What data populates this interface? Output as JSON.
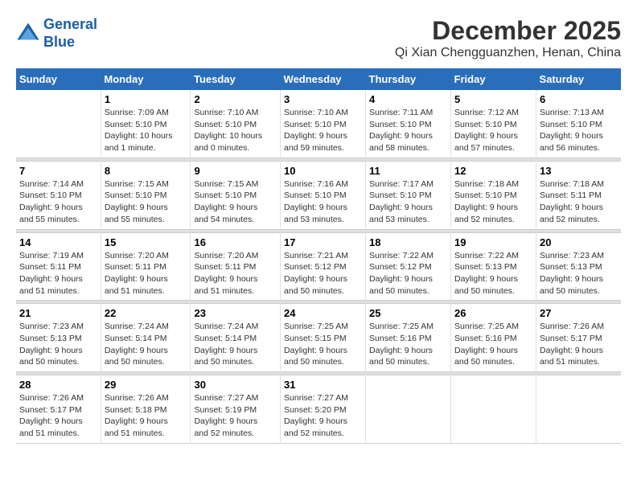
{
  "logo": {
    "line1": "General",
    "line2": "Blue"
  },
  "title": "December 2025",
  "location": "Qi Xian Chengguanzhen, Henan, China",
  "weekdays": [
    "Sunday",
    "Monday",
    "Tuesday",
    "Wednesday",
    "Thursday",
    "Friday",
    "Saturday"
  ],
  "weeks": [
    [
      {
        "day": "",
        "info": ""
      },
      {
        "day": "1",
        "info": "Sunrise: 7:09 AM\nSunset: 5:10 PM\nDaylight: 10 hours\nand 1 minute."
      },
      {
        "day": "2",
        "info": "Sunrise: 7:10 AM\nSunset: 5:10 PM\nDaylight: 10 hours\nand 0 minutes."
      },
      {
        "day": "3",
        "info": "Sunrise: 7:10 AM\nSunset: 5:10 PM\nDaylight: 9 hours\nand 59 minutes."
      },
      {
        "day": "4",
        "info": "Sunrise: 7:11 AM\nSunset: 5:10 PM\nDaylight: 9 hours\nand 58 minutes."
      },
      {
        "day": "5",
        "info": "Sunrise: 7:12 AM\nSunset: 5:10 PM\nDaylight: 9 hours\nand 57 minutes."
      },
      {
        "day": "6",
        "info": "Sunrise: 7:13 AM\nSunset: 5:10 PM\nDaylight: 9 hours\nand 56 minutes."
      }
    ],
    [
      {
        "day": "7",
        "info": "Sunrise: 7:14 AM\nSunset: 5:10 PM\nDaylight: 9 hours\nand 55 minutes."
      },
      {
        "day": "8",
        "info": "Sunrise: 7:15 AM\nSunset: 5:10 PM\nDaylight: 9 hours\nand 55 minutes."
      },
      {
        "day": "9",
        "info": "Sunrise: 7:15 AM\nSunset: 5:10 PM\nDaylight: 9 hours\nand 54 minutes."
      },
      {
        "day": "10",
        "info": "Sunrise: 7:16 AM\nSunset: 5:10 PM\nDaylight: 9 hours\nand 53 minutes."
      },
      {
        "day": "11",
        "info": "Sunrise: 7:17 AM\nSunset: 5:10 PM\nDaylight: 9 hours\nand 53 minutes."
      },
      {
        "day": "12",
        "info": "Sunrise: 7:18 AM\nSunset: 5:10 PM\nDaylight: 9 hours\nand 52 minutes."
      },
      {
        "day": "13",
        "info": "Sunrise: 7:18 AM\nSunset: 5:11 PM\nDaylight: 9 hours\nand 52 minutes."
      }
    ],
    [
      {
        "day": "14",
        "info": "Sunrise: 7:19 AM\nSunset: 5:11 PM\nDaylight: 9 hours\nand 51 minutes."
      },
      {
        "day": "15",
        "info": "Sunrise: 7:20 AM\nSunset: 5:11 PM\nDaylight: 9 hours\nand 51 minutes."
      },
      {
        "day": "16",
        "info": "Sunrise: 7:20 AM\nSunset: 5:11 PM\nDaylight: 9 hours\nand 51 minutes."
      },
      {
        "day": "17",
        "info": "Sunrise: 7:21 AM\nSunset: 5:12 PM\nDaylight: 9 hours\nand 50 minutes."
      },
      {
        "day": "18",
        "info": "Sunrise: 7:22 AM\nSunset: 5:12 PM\nDaylight: 9 hours\nand 50 minutes."
      },
      {
        "day": "19",
        "info": "Sunrise: 7:22 AM\nSunset: 5:13 PM\nDaylight: 9 hours\nand 50 minutes."
      },
      {
        "day": "20",
        "info": "Sunrise: 7:23 AM\nSunset: 5:13 PM\nDaylight: 9 hours\nand 50 minutes."
      }
    ],
    [
      {
        "day": "21",
        "info": "Sunrise: 7:23 AM\nSunset: 5:13 PM\nDaylight: 9 hours\nand 50 minutes."
      },
      {
        "day": "22",
        "info": "Sunrise: 7:24 AM\nSunset: 5:14 PM\nDaylight: 9 hours\nand 50 minutes."
      },
      {
        "day": "23",
        "info": "Sunrise: 7:24 AM\nSunset: 5:14 PM\nDaylight: 9 hours\nand 50 minutes."
      },
      {
        "day": "24",
        "info": "Sunrise: 7:25 AM\nSunset: 5:15 PM\nDaylight: 9 hours\nand 50 minutes."
      },
      {
        "day": "25",
        "info": "Sunrise: 7:25 AM\nSunset: 5:16 PM\nDaylight: 9 hours\nand 50 minutes."
      },
      {
        "day": "26",
        "info": "Sunrise: 7:25 AM\nSunset: 5:16 PM\nDaylight: 9 hours\nand 50 minutes."
      },
      {
        "day": "27",
        "info": "Sunrise: 7:26 AM\nSunset: 5:17 PM\nDaylight: 9 hours\nand 51 minutes."
      }
    ],
    [
      {
        "day": "28",
        "info": "Sunrise: 7:26 AM\nSunset: 5:17 PM\nDaylight: 9 hours\nand 51 minutes."
      },
      {
        "day": "29",
        "info": "Sunrise: 7:26 AM\nSunset: 5:18 PM\nDaylight: 9 hours\nand 51 minutes."
      },
      {
        "day": "30",
        "info": "Sunrise: 7:27 AM\nSunset: 5:19 PM\nDaylight: 9 hours\nand 52 minutes."
      },
      {
        "day": "31",
        "info": "Sunrise: 7:27 AM\nSunset: 5:20 PM\nDaylight: 9 hours\nand 52 minutes."
      },
      {
        "day": "",
        "info": ""
      },
      {
        "day": "",
        "info": ""
      },
      {
        "day": "",
        "info": ""
      }
    ]
  ]
}
